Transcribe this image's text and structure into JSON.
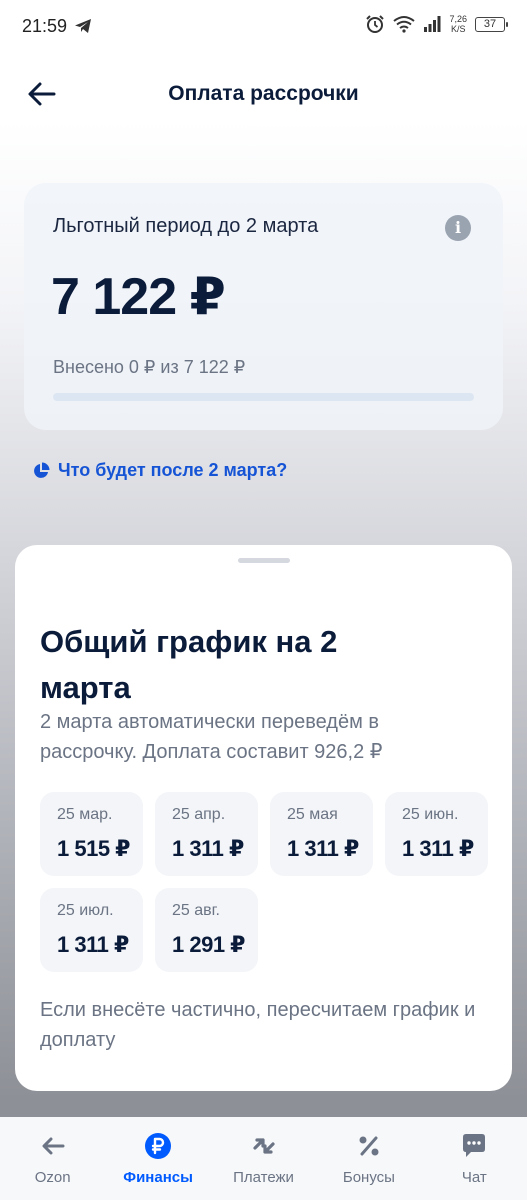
{
  "status": {
    "time": "21:59",
    "speed_top": "7,26",
    "speed_bottom": "K/S",
    "battery": "37"
  },
  "header": {
    "title": "Оплата рассрочки"
  },
  "grace": {
    "label": "Льготный период до 2 марта",
    "amount": "7 122 ₽",
    "paid_text": "Внесено 0 ₽ из 7 122 ₽",
    "paid_fraction": 0
  },
  "link": {
    "text": "Что будет после 2 марта?"
  },
  "sheet": {
    "title": "Общий график на 2 марта",
    "description": "2 марта автоматически переведём в рассрочку. Доплата составит 926,2 ₽",
    "payments": [
      {
        "date": "25 мар.",
        "amount": "1 515 ₽"
      },
      {
        "date": "25 апр.",
        "amount": "1 311 ₽"
      },
      {
        "date": "25 мая",
        "amount": "1 311 ₽"
      },
      {
        "date": "25 июн.",
        "amount": "1 311 ₽"
      },
      {
        "date": "25 июл.",
        "amount": "1 311 ₽"
      },
      {
        "date": "25 авг.",
        "amount": "1 291 ₽"
      }
    ],
    "note": "Если внесёте частично, пересчитаем график и доплату"
  },
  "nav": {
    "items": [
      {
        "label": "Ozon",
        "icon": "ozon-arrow-icon"
      },
      {
        "label": "Финансы",
        "icon": "ruble-icon",
        "active": true
      },
      {
        "label": "Платежи",
        "icon": "transfer-arrows-icon"
      },
      {
        "label": "Бонусы",
        "icon": "percent-icon"
      },
      {
        "label": "Чат",
        "icon": "chat-bubble-icon"
      }
    ]
  },
  "colors": {
    "accent": "#005bff",
    "link": "#1654d6",
    "text_primary": "#0b1b3a",
    "text_secondary": "#6b7484"
  }
}
